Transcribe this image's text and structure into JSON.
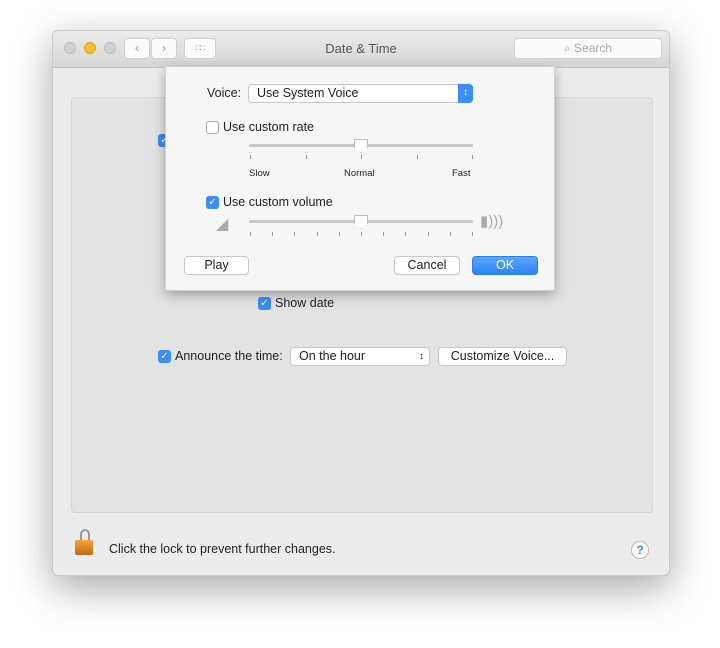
{
  "window": {
    "title": "Date & Time",
    "search_placeholder": "Search"
  },
  "main": {
    "show_date_label": "Show date",
    "show_date_checked": true,
    "announce_label": "Announce the time:",
    "announce_checked": true,
    "announce_value": "On the hour",
    "customize_voice_label": "Customize Voice..."
  },
  "footer": {
    "lock_text": "Click the lock to prevent further changes.",
    "help_label": "?"
  },
  "sheet": {
    "voice_label": "Voice:",
    "voice_value": "Use System Voice",
    "custom_rate_label": "Use custom rate",
    "custom_rate_checked": false,
    "rate_value": 0.5,
    "rate_labels": {
      "slow": "Slow",
      "normal": "Normal",
      "fast": "Fast"
    },
    "custom_volume_label": "Use custom volume",
    "custom_volume_checked": true,
    "volume_value": 0.5,
    "play_label": "Play",
    "cancel_label": "Cancel",
    "ok_label": "OK"
  },
  "colors": {
    "accent": "#3b8ef5",
    "close_yellow": "#f5bd2f"
  }
}
